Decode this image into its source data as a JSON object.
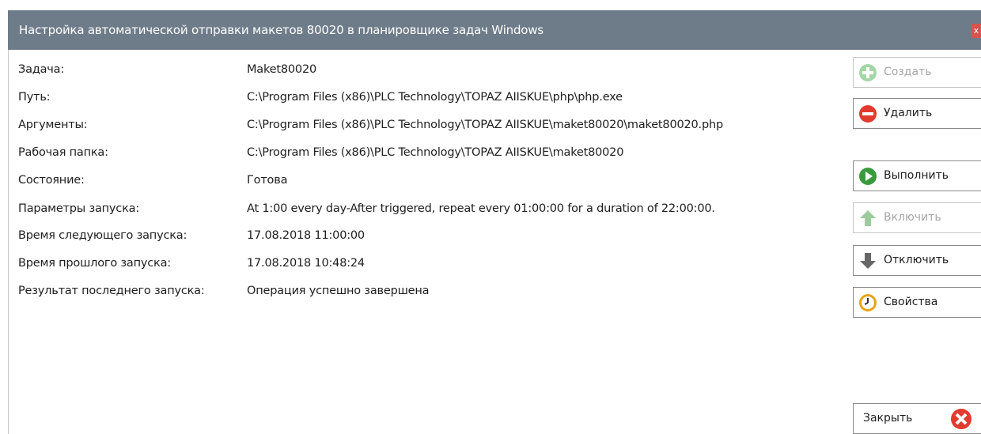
{
  "window": {
    "title": "Настройка автоматической отправки макетов 80020 в планировщике задач Windows",
    "close_glyph": "x"
  },
  "fields": [
    {
      "label": "Задача:",
      "value": "Maket80020"
    },
    {
      "label": "Путь:",
      "value": "C:\\Program Files (x86)\\PLC Technology\\TOPAZ AIISKUE\\php\\php.exe"
    },
    {
      "label": "Аргументы:",
      "value": "C:\\Program Files (x86)\\PLC Technology\\TOPAZ AIISKUE\\maket80020\\maket80020.php"
    },
    {
      "label": "Рабочая папка:",
      "value": "C:\\Program Files (x86)\\PLC Technology\\TOPAZ AIISKUE\\maket80020"
    },
    {
      "label": "Состояние:",
      "value": "Готова"
    },
    {
      "label": "Параметры запуска:",
      "value": "At 1:00 every day-After triggered, repeat every 01:00:00 for a duration of 22:00:00."
    },
    {
      "label": "Время следующего запуска:",
      "value": "17.08.2018 11:00:00"
    },
    {
      "label": "Время прошлого запуска:",
      "value": "17.08.2018 10:48:24"
    },
    {
      "label": "Результат последнего запуска:",
      "value": "Операция успешно завершена"
    }
  ],
  "buttons": {
    "create": {
      "label": "Создать",
      "icon": "plus-circle-icon",
      "enabled": false
    },
    "delete": {
      "label": "Удалить",
      "icon": "minus-circle-icon",
      "enabled": true
    },
    "run": {
      "label": "Выполнить",
      "icon": "play-circle-icon",
      "enabled": true
    },
    "enable": {
      "label": "Включить",
      "icon": "arrow-up-icon",
      "enabled": false
    },
    "disable": {
      "label": "Отключить",
      "icon": "arrow-down-icon",
      "enabled": true
    },
    "properties": {
      "label": "Свойства",
      "icon": "clock-icon",
      "enabled": true
    },
    "close": {
      "label": "Закрыть",
      "icon": "close-circle-icon",
      "enabled": true
    }
  },
  "colors": {
    "titlebar": "#6e7c8a",
    "green": "#4caf50",
    "red": "#e23b2e",
    "gray_arrow": "#666666",
    "clock_gold": "#e8a317"
  }
}
